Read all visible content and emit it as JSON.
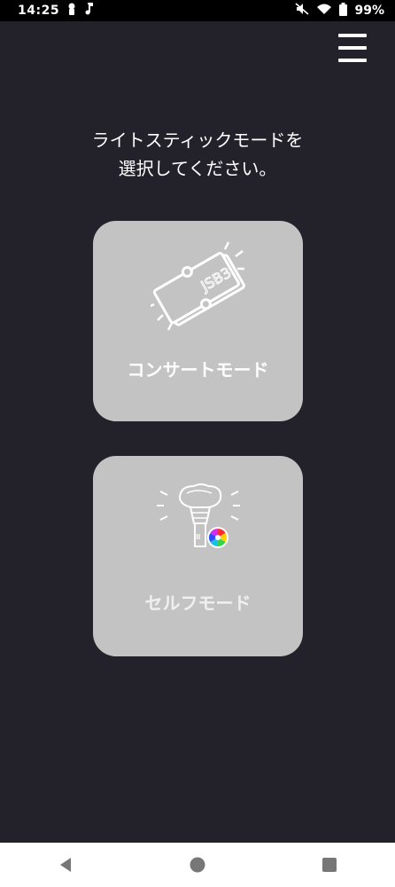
{
  "status_bar": {
    "time": "14:25",
    "battery_percent": "99%",
    "icons": [
      "person-icon",
      "music-note-icon",
      "mute-icon",
      "wifi-icon",
      "battery-icon"
    ]
  },
  "header": {
    "menu_icon": "hamburger-menu-icon"
  },
  "prompt": {
    "line1": "ライトスティックモードを",
    "line2": "選択してください。"
  },
  "modes": [
    {
      "label": "コンサートモード",
      "icon": "ticket-icon",
      "ticket_text": "JSB3"
    },
    {
      "label": "セルフモード",
      "icon": "lightstick-icon"
    }
  ],
  "nav": {
    "buttons": [
      "back-icon",
      "home-icon",
      "recents-icon"
    ]
  },
  "colors": {
    "background": "#23222a",
    "card": "#c3c3c3",
    "status_bar": "#000000",
    "nav_bar": "#ffffff"
  }
}
